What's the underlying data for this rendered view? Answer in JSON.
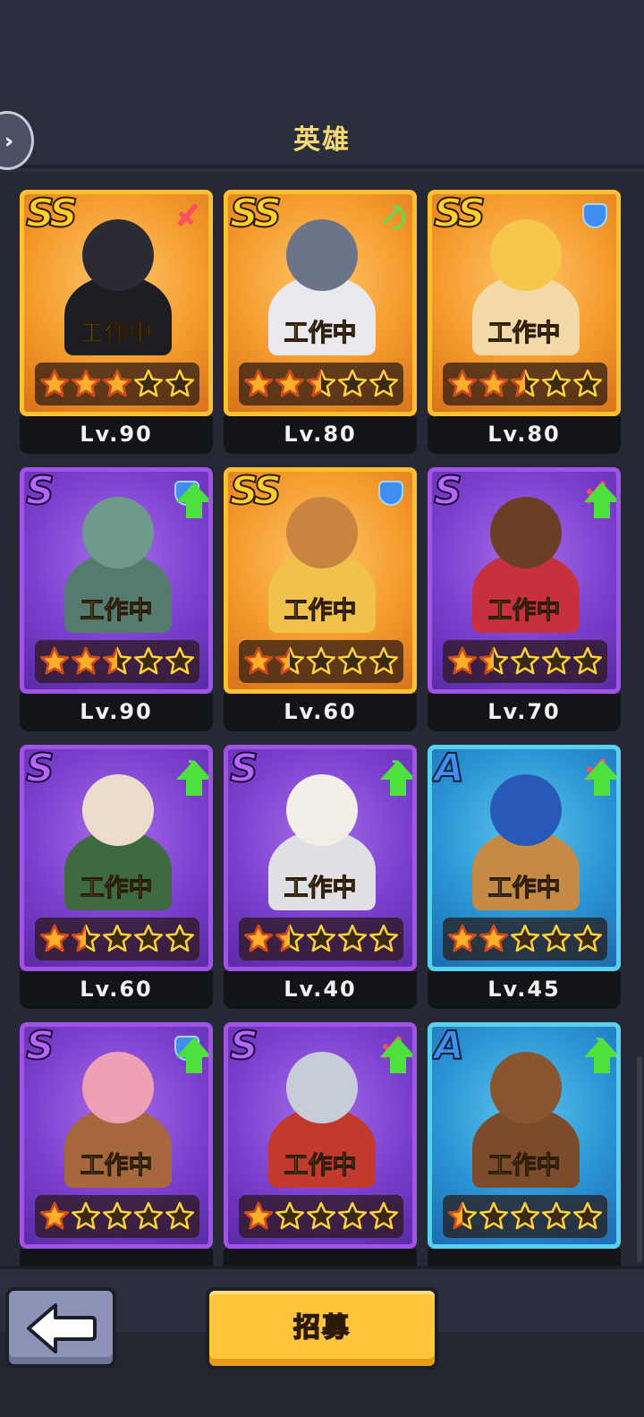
{
  "header": {
    "title": "英雄"
  },
  "side_tab": {
    "icon": "double-chevron-right-icon"
  },
  "heroes": [
    {
      "rank": "SS",
      "tier": "ss",
      "role": "sword",
      "upgrade": false,
      "status": "工作中",
      "stars": 3,
      "level": "Lv.90",
      "colors": {
        "head": "#2b2b33",
        "body": "#1d1d24"
      }
    },
    {
      "rank": "SS",
      "tier": "ss",
      "role": "bow",
      "upgrade": false,
      "status": "工作中",
      "stars": 2.5,
      "level": "Lv.80",
      "colors": {
        "head": "#6b7488",
        "body": "#e9e9ef"
      }
    },
    {
      "rank": "SS",
      "tier": "ss",
      "role": "shield",
      "upgrade": false,
      "status": "工作中",
      "stars": 2.5,
      "level": "Lv.80",
      "colors": {
        "head": "#f6c74a",
        "body": "#f4d9a8"
      }
    },
    {
      "rank": "S",
      "tier": "s",
      "role": "shield",
      "upgrade": true,
      "status": "工作中",
      "stars": 2.5,
      "level": "Lv.90",
      "colors": {
        "head": "#6e9a8c",
        "body": "#557a70"
      }
    },
    {
      "rank": "SS",
      "tier": "ss",
      "role": "shield",
      "upgrade": false,
      "status": "工作中",
      "stars": 1.5,
      "level": "Lv.60",
      "colors": {
        "head": "#c98540",
        "body": "#f0c24a"
      }
    },
    {
      "rank": "S",
      "tier": "s",
      "role": "sword",
      "upgrade": true,
      "status": "工作中",
      "stars": 1.5,
      "level": "Lv.70",
      "colors": {
        "head": "#6b3f26",
        "body": "#c9303d"
      }
    },
    {
      "rank": "S",
      "tier": "s",
      "role": "bow",
      "upgrade": true,
      "status": "工作中",
      "stars": 1.5,
      "level": "Lv.60",
      "colors": {
        "head": "#ecdccb",
        "body": "#3e6a3f"
      }
    },
    {
      "rank": "S",
      "tier": "s",
      "role": "bow",
      "upgrade": true,
      "status": "工作中",
      "stars": 1.5,
      "level": "Lv.40",
      "colors": {
        "head": "#f2efe8",
        "body": "#dfe0e4"
      }
    },
    {
      "rank": "A",
      "tier": "a",
      "role": "sword",
      "upgrade": true,
      "status": "工作中",
      "stars": 2,
      "level": "Lv.45",
      "colors": {
        "head": "#2859b8",
        "body": "#c58a45"
      }
    },
    {
      "rank": "S",
      "tier": "s",
      "role": "shield",
      "upgrade": true,
      "status": "工作中",
      "stars": 1,
      "level": "",
      "colors": {
        "head": "#f0a0b5",
        "body": "#a7673d"
      }
    },
    {
      "rank": "S",
      "tier": "s",
      "role": "sword",
      "upgrade": true,
      "status": "工作中",
      "stars": 1,
      "level": "",
      "colors": {
        "head": "#c6ccd8",
        "body": "#c23a2e"
      }
    },
    {
      "rank": "A",
      "tier": "a",
      "role": "bow",
      "upgrade": true,
      "status": "工作中",
      "stars": 0.5,
      "level": "",
      "colors": {
        "head": "#8a5630",
        "body": "#7c4b2b"
      }
    }
  ],
  "footer": {
    "back_icon": "arrow-left-icon",
    "recruit_label": "招募"
  },
  "colors": {
    "background": "#2b2e3c",
    "star_fill": "#ffb02a",
    "star_empty_outline": "#ffd23a",
    "recruit_button": "#ffc53c",
    "back_button": "#8c93b6"
  }
}
